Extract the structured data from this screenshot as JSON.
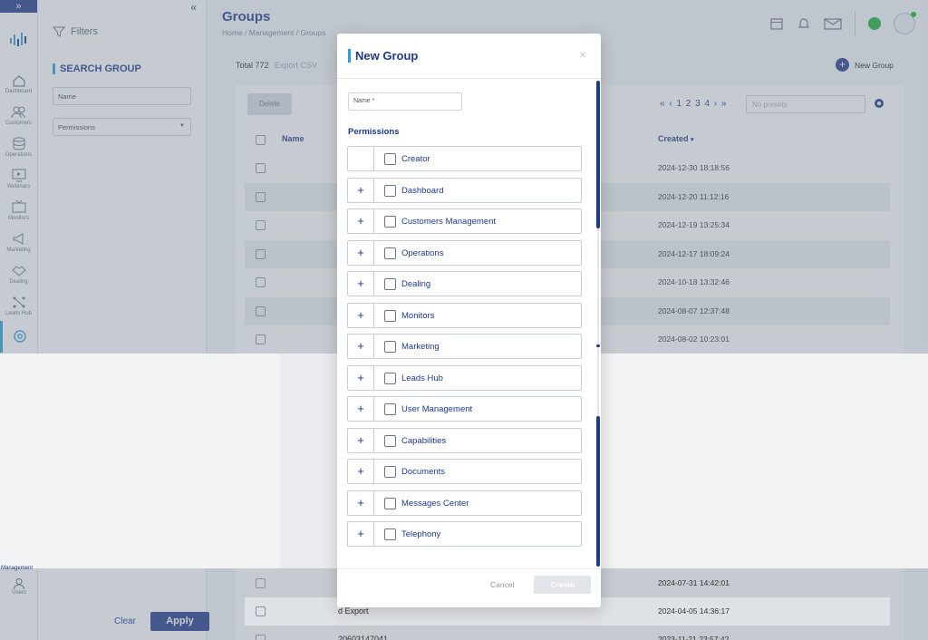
{
  "nav": {
    "items": [
      {
        "label": "Dashboard",
        "icon": "home-icon"
      },
      {
        "label": "Customers",
        "icon": "customers-icon"
      },
      {
        "label": "Operations",
        "icon": "database-icon"
      },
      {
        "label": "Webinars",
        "icon": "webinar-icon"
      },
      {
        "label": "Monitors",
        "icon": "tv-icon"
      },
      {
        "label": "Marketing",
        "icon": "megaphone-icon"
      },
      {
        "label": "Dealing",
        "icon": "handshake-icon"
      },
      {
        "label": "Leads Hub",
        "icon": "network-icon"
      },
      {
        "label": "",
        "icon": "gear-icon"
      }
    ],
    "bottom_items": [
      {
        "label": "Users",
        "icon": "user-icon"
      }
    ],
    "partial_label": "Management"
  },
  "filters": {
    "title": "Filters",
    "section_title": "SEARCH GROUP",
    "name_field": "Name",
    "permissions_select": "Permissions",
    "clear_label": "Clear",
    "apply_label": "Apply"
  },
  "header": {
    "title": "Groups",
    "breadcrumb": "Home / Management / Groups"
  },
  "toolbar": {
    "total": "Total 772",
    "export": "Export CSV",
    "new_group": "New Group",
    "delete": "Delete",
    "pager": "« ‹ 1 2 3 4 › »",
    "presets_placeholder": "No presets"
  },
  "table": {
    "columns": [
      "Name",
      "Created"
    ],
    "rows": [
      {
        "created": "2024-12-30 18:18:56"
      },
      {
        "created": "2024-12-20 11:12:16"
      },
      {
        "created": "2024-12-19 13:25:34"
      },
      {
        "created": "2024-12-17 18:09:24"
      },
      {
        "created": "2024-10-18 13:32:46"
      },
      {
        "created": "2024-08-07 12:37:48"
      },
      {
        "created": "2024-08-02 10:23:01"
      }
    ],
    "bottom_rows": [
      {
        "name": "",
        "created": "2024-07-31 14:42:01"
      },
      {
        "name": "d Export",
        "created": "2024-04-05 14:36:17"
      },
      {
        "name": "20603147041",
        "created": "2023-11-21 23:57:42"
      }
    ]
  },
  "modal": {
    "title": "New Group",
    "close": "×",
    "name_placeholder": "Name *",
    "permissions_title": "Permissions",
    "permissions": [
      {
        "label": "Creator",
        "expandable": false
      },
      {
        "label": "Dashboard",
        "expandable": true
      },
      {
        "label": "Customers Management",
        "expandable": true
      },
      {
        "label": "Operations",
        "expandable": true
      },
      {
        "label": "Dealing",
        "expandable": true
      },
      {
        "label": "Monitors",
        "expandable": true
      },
      {
        "label": "Marketing",
        "expandable": true
      },
      {
        "label": "Leads Hub",
        "expandable": true
      },
      {
        "label": "User Management",
        "expandable": true
      },
      {
        "label": "Capabilities",
        "expandable": true
      },
      {
        "label": "Documents",
        "expandable": true
      },
      {
        "label": "Messages Center",
        "expandable": true
      },
      {
        "label": "Telephony",
        "expandable": true
      }
    ],
    "cancel": "Cancel",
    "create": "Create"
  },
  "colors": {
    "primary": "#1f3a8a",
    "accent": "#2a9fd6",
    "status_online": "#1aaf3c"
  }
}
